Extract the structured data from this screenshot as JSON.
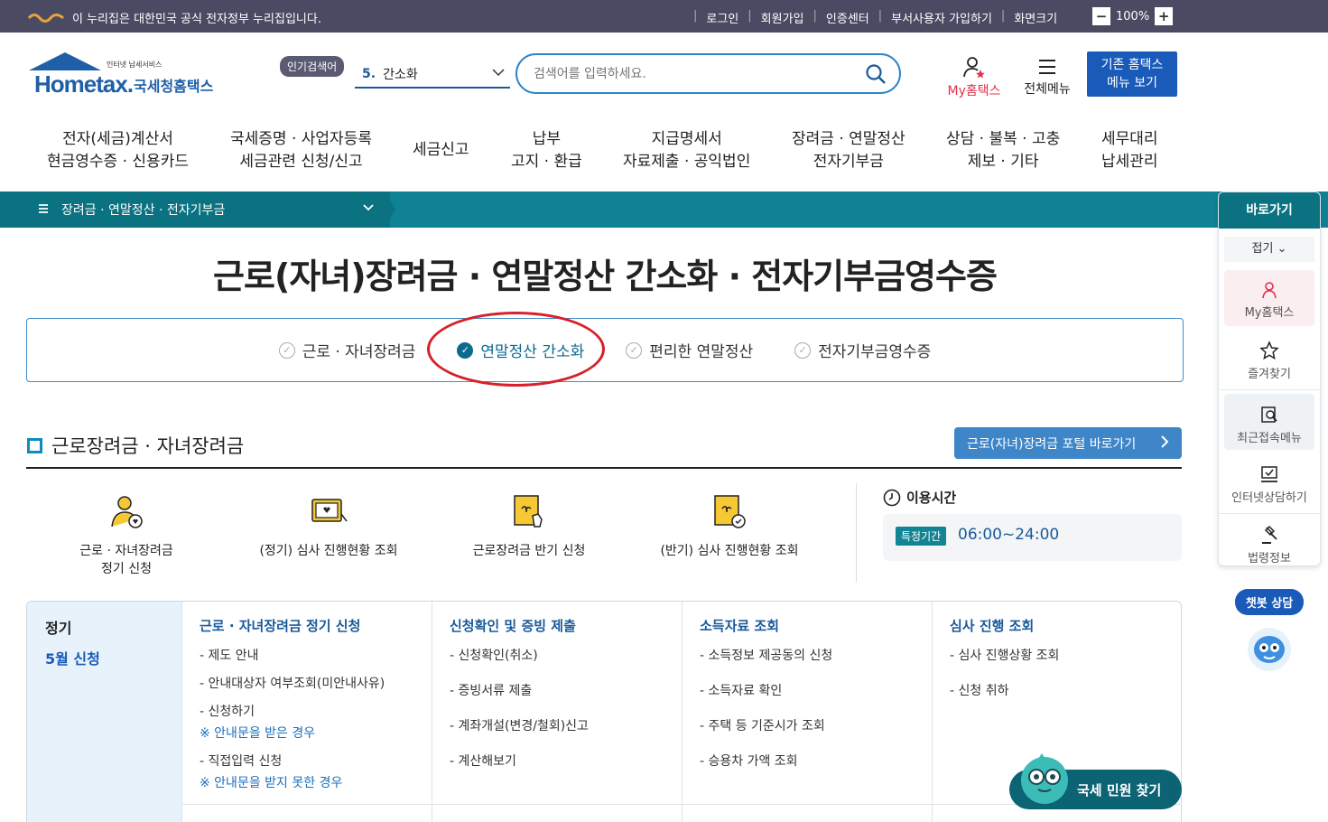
{
  "topbar": {
    "gov_notice": "이 누리집은 대한민국 공식 전자정부 누리집입니다.",
    "links": [
      "로그인",
      "회원가입",
      "인증센터",
      "부서사용자 가입하기",
      "화면크기"
    ],
    "zoom_minus": "−",
    "zoom_value": "100%",
    "zoom_plus": "+"
  },
  "header": {
    "logo_small": "인터넷 납세서비스",
    "logo_en": "Hometax.",
    "logo_kr": "국세청홈택스",
    "popular_label": "인기검색어",
    "popular_rank": "5.",
    "popular_term": "간소화",
    "search_placeholder": "검색어를 입력하세요.",
    "myhometax": "My홈택스",
    "allmenu": "전체메뉴",
    "oldmenu_line1": "기존 홈택스",
    "oldmenu_line2": "메뉴 보기"
  },
  "gnb": [
    {
      "l1": "전자(세금)계산서",
      "l2": "현금영수증 · 신용카드"
    },
    {
      "l1": "국세증명 · 사업자등록",
      "l2": "세금관련 신청/신고"
    },
    {
      "l1": "세금신고",
      "l2": ""
    },
    {
      "l1": "납부",
      "l2": "고지 · 환급"
    },
    {
      "l1": "지급명세서",
      "l2": "자료제출 · 공익법인"
    },
    {
      "l1": "장려금 · 연말정산",
      "l2": "전자기부금"
    },
    {
      "l1": "상담 · 불복 · 고충",
      "l2": "제보 · 기타"
    },
    {
      "l1": "세무대리",
      "l2": "납세관리"
    }
  ],
  "breadcrumb": {
    "label": "장려금 · 연말정산 · 전자기부금"
  },
  "page_title": "근로(자녀)장려금 · 연말정산 간소화 · 전자기부금영수증",
  "tabs": [
    {
      "label": "근로 · 자녀장려금",
      "active": false
    },
    {
      "label": "연말정산 간소화",
      "active": true
    },
    {
      "label": "편리한 연말정산",
      "active": false
    },
    {
      "label": "전자기부금영수증",
      "active": false
    }
  ],
  "section": {
    "title": "근로장려금 · 자녀장려금",
    "portal_button": "근로(자녀)장려금 포털 바로가기"
  },
  "shortcuts": [
    {
      "l1": "근로 · 자녀장려금",
      "l2": "정기 신청",
      "icon": "person-heart-icon"
    },
    {
      "l1": "(정기) 심사 진행현황 조회",
      "l2": "",
      "icon": "monitor-heart-icon"
    },
    {
      "l1": "근로장려금 반기 신청",
      "l2": "",
      "icon": "document-hand-icon"
    },
    {
      "l1": "(반기) 심사 진행현황 조회",
      "l2": "",
      "icon": "document-check-icon"
    }
  ],
  "usetime": {
    "label": "이용시간",
    "badge": "특정기간",
    "value": "06:00~24:00"
  },
  "table": {
    "lead_a": "정기",
    "lead_b": "5월 신청",
    "columns": [
      {
        "header": "근로 · 자녀장려금 정기 신청",
        "items": [
          "- 제도 안내",
          "- 안내대상자 여부조회(미안내사유)",
          "- 신청하기",
          "※ 안내문을 받은 경우",
          "- 직접입력 신청",
          "※ 안내문을 받지 못한 경우"
        ]
      },
      {
        "header": "신청확인 및 증빙 제출",
        "items": [
          "- 신청확인(취소)",
          "- 증빙서류 제출",
          "- 계좌개설(변경/철회)신고",
          "- 계산해보기"
        ]
      },
      {
        "header": "소득자료 조회",
        "items": [
          "- 소득정보 제공동의 신청",
          "- 소득자료 확인",
          "- 주택 등 기준시가 조회",
          "- 승용차 가액 조회"
        ]
      },
      {
        "header": "심사 진행 조회",
        "items": [
          "- 심사 진행상황 조회",
          "- 신청 취하"
        ]
      }
    ]
  },
  "sidebar": {
    "title": "바로가기",
    "fold": "접기 ⌄",
    "items": [
      "My홈택스",
      "즐겨찾기",
      "최근접속메뉴",
      "인터넷상담하기",
      "법령정보"
    ]
  },
  "chatbot": {
    "label": "챗봇 상담"
  },
  "fab": {
    "label": "국세 민원 찾기"
  },
  "colors": {
    "accent": "#0b7282",
    "brand": "#1a5ab8",
    "highlight": "#d8202a"
  }
}
